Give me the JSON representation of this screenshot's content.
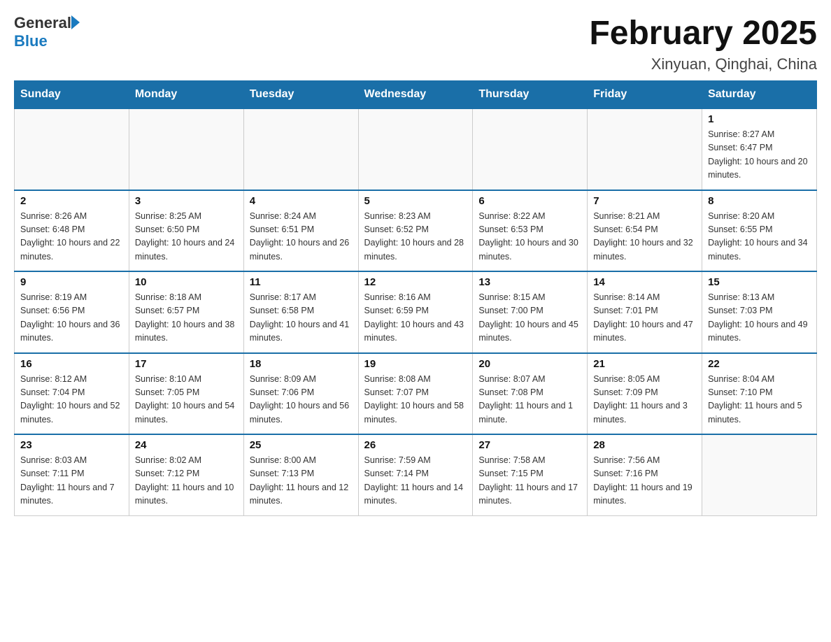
{
  "logo": {
    "general": "General",
    "blue": "Blue"
  },
  "title": "February 2025",
  "subtitle": "Xinyuan, Qinghai, China",
  "days_of_week": [
    "Sunday",
    "Monday",
    "Tuesday",
    "Wednesday",
    "Thursday",
    "Friday",
    "Saturday"
  ],
  "weeks": [
    [
      {
        "day": "",
        "info": ""
      },
      {
        "day": "",
        "info": ""
      },
      {
        "day": "",
        "info": ""
      },
      {
        "day": "",
        "info": ""
      },
      {
        "day": "",
        "info": ""
      },
      {
        "day": "",
        "info": ""
      },
      {
        "day": "1",
        "info": "Sunrise: 8:27 AM\nSunset: 6:47 PM\nDaylight: 10 hours and 20 minutes."
      }
    ],
    [
      {
        "day": "2",
        "info": "Sunrise: 8:26 AM\nSunset: 6:48 PM\nDaylight: 10 hours and 22 minutes."
      },
      {
        "day": "3",
        "info": "Sunrise: 8:25 AM\nSunset: 6:50 PM\nDaylight: 10 hours and 24 minutes."
      },
      {
        "day": "4",
        "info": "Sunrise: 8:24 AM\nSunset: 6:51 PM\nDaylight: 10 hours and 26 minutes."
      },
      {
        "day": "5",
        "info": "Sunrise: 8:23 AM\nSunset: 6:52 PM\nDaylight: 10 hours and 28 minutes."
      },
      {
        "day": "6",
        "info": "Sunrise: 8:22 AM\nSunset: 6:53 PM\nDaylight: 10 hours and 30 minutes."
      },
      {
        "day": "7",
        "info": "Sunrise: 8:21 AM\nSunset: 6:54 PM\nDaylight: 10 hours and 32 minutes."
      },
      {
        "day": "8",
        "info": "Sunrise: 8:20 AM\nSunset: 6:55 PM\nDaylight: 10 hours and 34 minutes."
      }
    ],
    [
      {
        "day": "9",
        "info": "Sunrise: 8:19 AM\nSunset: 6:56 PM\nDaylight: 10 hours and 36 minutes."
      },
      {
        "day": "10",
        "info": "Sunrise: 8:18 AM\nSunset: 6:57 PM\nDaylight: 10 hours and 38 minutes."
      },
      {
        "day": "11",
        "info": "Sunrise: 8:17 AM\nSunset: 6:58 PM\nDaylight: 10 hours and 41 minutes."
      },
      {
        "day": "12",
        "info": "Sunrise: 8:16 AM\nSunset: 6:59 PM\nDaylight: 10 hours and 43 minutes."
      },
      {
        "day": "13",
        "info": "Sunrise: 8:15 AM\nSunset: 7:00 PM\nDaylight: 10 hours and 45 minutes."
      },
      {
        "day": "14",
        "info": "Sunrise: 8:14 AM\nSunset: 7:01 PM\nDaylight: 10 hours and 47 minutes."
      },
      {
        "day": "15",
        "info": "Sunrise: 8:13 AM\nSunset: 7:03 PM\nDaylight: 10 hours and 49 minutes."
      }
    ],
    [
      {
        "day": "16",
        "info": "Sunrise: 8:12 AM\nSunset: 7:04 PM\nDaylight: 10 hours and 52 minutes."
      },
      {
        "day": "17",
        "info": "Sunrise: 8:10 AM\nSunset: 7:05 PM\nDaylight: 10 hours and 54 minutes."
      },
      {
        "day": "18",
        "info": "Sunrise: 8:09 AM\nSunset: 7:06 PM\nDaylight: 10 hours and 56 minutes."
      },
      {
        "day": "19",
        "info": "Sunrise: 8:08 AM\nSunset: 7:07 PM\nDaylight: 10 hours and 58 minutes."
      },
      {
        "day": "20",
        "info": "Sunrise: 8:07 AM\nSunset: 7:08 PM\nDaylight: 11 hours and 1 minute."
      },
      {
        "day": "21",
        "info": "Sunrise: 8:05 AM\nSunset: 7:09 PM\nDaylight: 11 hours and 3 minutes."
      },
      {
        "day": "22",
        "info": "Sunrise: 8:04 AM\nSunset: 7:10 PM\nDaylight: 11 hours and 5 minutes."
      }
    ],
    [
      {
        "day": "23",
        "info": "Sunrise: 8:03 AM\nSunset: 7:11 PM\nDaylight: 11 hours and 7 minutes."
      },
      {
        "day": "24",
        "info": "Sunrise: 8:02 AM\nSunset: 7:12 PM\nDaylight: 11 hours and 10 minutes."
      },
      {
        "day": "25",
        "info": "Sunrise: 8:00 AM\nSunset: 7:13 PM\nDaylight: 11 hours and 12 minutes."
      },
      {
        "day": "26",
        "info": "Sunrise: 7:59 AM\nSunset: 7:14 PM\nDaylight: 11 hours and 14 minutes."
      },
      {
        "day": "27",
        "info": "Sunrise: 7:58 AM\nSunset: 7:15 PM\nDaylight: 11 hours and 17 minutes."
      },
      {
        "day": "28",
        "info": "Sunrise: 7:56 AM\nSunset: 7:16 PM\nDaylight: 11 hours and 19 minutes."
      },
      {
        "day": "",
        "info": ""
      }
    ]
  ]
}
